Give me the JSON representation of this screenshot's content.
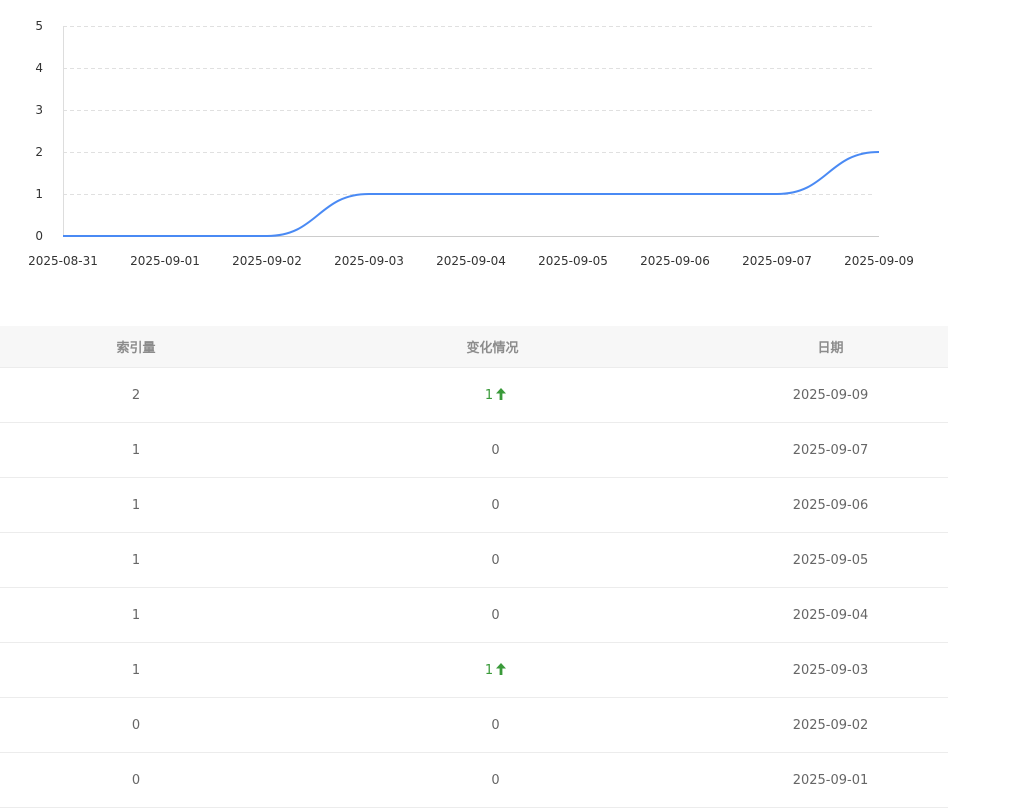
{
  "chart_data": {
    "type": "line",
    "x": [
      "2025-08-31",
      "2025-09-01",
      "2025-09-02",
      "2025-09-03",
      "2025-09-04",
      "2025-09-05",
      "2025-09-06",
      "2025-09-07",
      "2025-09-09"
    ],
    "series": [
      {
        "values": [
          0,
          0,
          0,
          1,
          1,
          1,
          1,
          1,
          2
        ]
      }
    ],
    "y_ticks": [
      "0",
      "1",
      "2",
      "3",
      "4",
      "5"
    ],
    "ylim": [
      0,
      5
    ],
    "title": "",
    "xlabel": "",
    "ylabel": "",
    "grid": "horizontal dashed",
    "line_color": "#4a8af4",
    "smooth": true
  },
  "table": {
    "headers": {
      "amount": "索引量",
      "change": "变化情况",
      "date": "日期"
    },
    "rows": [
      {
        "amount": "2",
        "change": "1",
        "trend": "up",
        "date": "2025-09-09"
      },
      {
        "amount": "1",
        "change": "0",
        "trend": "none",
        "date": "2025-09-07"
      },
      {
        "amount": "1",
        "change": "0",
        "trend": "none",
        "date": "2025-09-06"
      },
      {
        "amount": "1",
        "change": "0",
        "trend": "none",
        "date": "2025-09-05"
      },
      {
        "amount": "1",
        "change": "0",
        "trend": "none",
        "date": "2025-09-04"
      },
      {
        "amount": "1",
        "change": "1",
        "trend": "up",
        "date": "2025-09-03"
      },
      {
        "amount": "0",
        "change": "0",
        "trend": "none",
        "date": "2025-09-02"
      },
      {
        "amount": "0",
        "change": "0",
        "trend": "none",
        "date": "2025-09-01"
      }
    ],
    "up_color": "#3a9a3a",
    "up_icon": "arrow-up-icon"
  }
}
